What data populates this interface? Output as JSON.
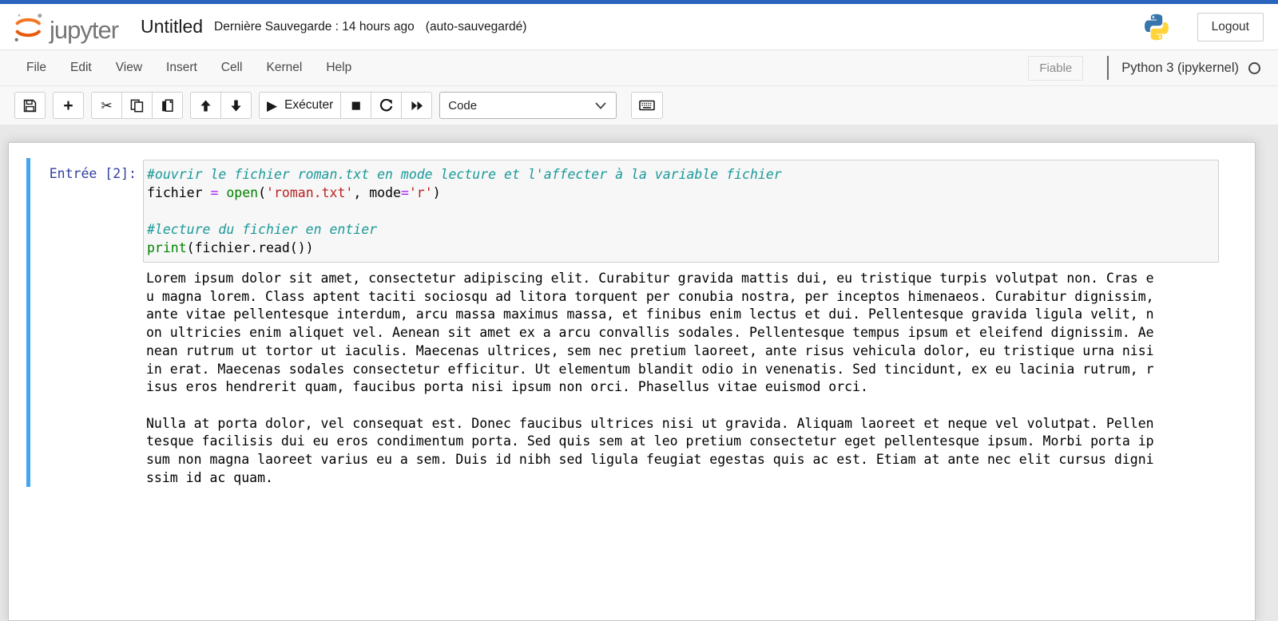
{
  "header": {
    "logo_text": "jupyter",
    "notebook_title": "Untitled",
    "save_status": "Dernière Sauvegarde : 14 hours ago",
    "autosave_status": "(auto-sauvegardé)",
    "logout_label": "Logout"
  },
  "menubar": {
    "items": [
      "File",
      "Edit",
      "View",
      "Insert",
      "Cell",
      "Kernel",
      "Help"
    ],
    "trusted_label": "Fiable",
    "kernel_name": "Python 3 (ipykernel)",
    "kernel_status": "idle"
  },
  "toolbar": {
    "icons": {
      "add": "+",
      "cut": "✂",
      "run": "▶",
      "stop": "■"
    },
    "run_label": "Exécuter",
    "cell_type_value": "Code"
  },
  "cell": {
    "prompt": "Entrée [2]:",
    "code_lines": [
      [
        [
          "com",
          "#ouvrir le fichier roman.txt en mode lecture et l'affecter à la variable fichier"
        ]
      ],
      [
        [
          "def",
          "fichier "
        ],
        [
          "op",
          "="
        ],
        [
          "def",
          " "
        ],
        [
          "bi",
          "open"
        ],
        [
          "def",
          "("
        ],
        [
          "str",
          "'roman.txt'"
        ],
        [
          "def",
          ", mode"
        ],
        [
          "op",
          "="
        ],
        [
          "str",
          "'r'"
        ],
        [
          "def",
          ")"
        ]
      ],
      [],
      [
        [
          "com",
          "#lecture du fichier en entier"
        ]
      ],
      [
        [
          "bi",
          "print"
        ],
        [
          "def",
          "(fichier.read())"
        ]
      ]
    ],
    "output_text": "Lorem ipsum dolor sit amet, consectetur adipiscing elit. Curabitur gravida mattis dui, eu tristique turpis volutpat non. Cras e\nu magna lorem. Class aptent taciti sociosqu ad litora torquent per conubia nostra, per inceptos himenaeos. Curabitur dignissim,\nante vitae pellentesque interdum, arcu massa maximus massa, et finibus enim lectus et dui. Pellentesque gravida ligula velit, n\non ultricies enim aliquet vel. Aenean sit amet ex a arcu convallis sodales. Pellentesque tempus ipsum et eleifend dignissim. Ae\nnean rutrum ut tortor ut iaculis. Maecenas ultrices, sem nec pretium laoreet, ante risus vehicula dolor, eu tristique urna nisi\nin erat. Maecenas sodales consectetur efficitur. Ut elementum blandit odio in venenatis. Sed tincidunt, ex eu lacinia rutrum, r\nisus eros hendrerit quam, faucibus porta nisi ipsum non orci. Phasellus vitae euismod orci.\n\nNulla at porta dolor, vel consequat est. Donec faucibus ultrices nisi ut gravida. Aliquam laoreet et neque vel volutpat. Pellen\ntesque facilisis dui eu eros condimentum porta. Sed quis sem at leo pretium consectetur eget pellentesque ipsum. Morbi porta ip\nsum non magna laoreet varius eu a sem. Duis id nibh sed ligula feugiat egestas quis ac est. Etiam at ante nec elit cursus digni\nssim id ac quam."
  },
  "colors": {
    "top_strip": "#2a63bd",
    "selected_cell_border": "#42A5F5",
    "jupyter_orange": "#F37626",
    "syntax_comment": "#1a9898",
    "syntax_operator": "#AA22FF",
    "syntax_builtin": "#008000",
    "syntax_string": "#BA2121",
    "prompt_navy": "#303F9F"
  }
}
